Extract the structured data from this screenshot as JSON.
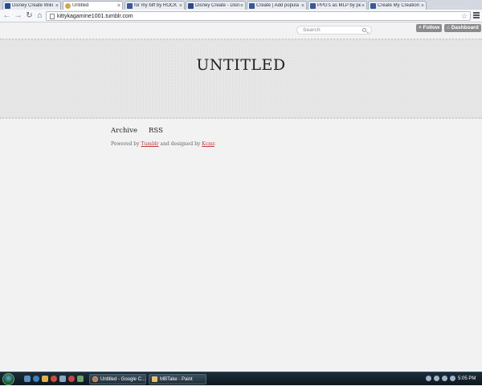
{
  "browser": {
    "tabs": [
      {
        "label": "Disney Create Wiki",
        "icon": "disney-favicon",
        "active": false
      },
      {
        "label": "Untitled",
        "icon": "cat-favicon",
        "active": true
      },
      {
        "label": "for my biff by ROCK",
        "icon": "deviantart-favicon",
        "active": false
      },
      {
        "label": "Disney Create - Disn",
        "icon": "disney-favicon",
        "active": false
      },
      {
        "label": "Create | Add popula",
        "icon": "deviantart-favicon",
        "active": false
      },
      {
        "label": "PPG's as MLP by pe",
        "icon": "deviantart-favicon",
        "active": false
      },
      {
        "label": "Create My Creation",
        "icon": "deviantart-favicon",
        "active": false
      }
    ],
    "tab_close_glyph": "×",
    "nav": {
      "back": "←",
      "forward": "→",
      "reload": "↻",
      "home": "⌂"
    },
    "url": "kittykagamine1001.tumblr.com",
    "star_glyph": "☆"
  },
  "tumblr_controls": {
    "search_placeholder": "Search",
    "follow_label": "+ Follow",
    "dashboard_label": "⌂ Dashboard"
  },
  "blog": {
    "title": "UNTITLED",
    "nav": {
      "archive": "Archive",
      "rss": "RSS"
    },
    "credit": {
      "prefix": "Powered by ",
      "tumblr": "Tumblr",
      "middle": " and designed by ",
      "designer": "Kcmr",
      "suffix": "."
    }
  },
  "taskbar": {
    "tasks": [
      {
        "label": "Untitled - Google C...",
        "icon": "chrome-icon"
      },
      {
        "label": "MBTake - Paint",
        "icon": "paint-icon"
      }
    ],
    "clock": "5:05 PM"
  },
  "colors": {
    "page_bg": "#f2f2f2",
    "header_bg": "#e6e6e6",
    "link_red": "#c23a3a",
    "taskbar": "#1d2e3a"
  }
}
